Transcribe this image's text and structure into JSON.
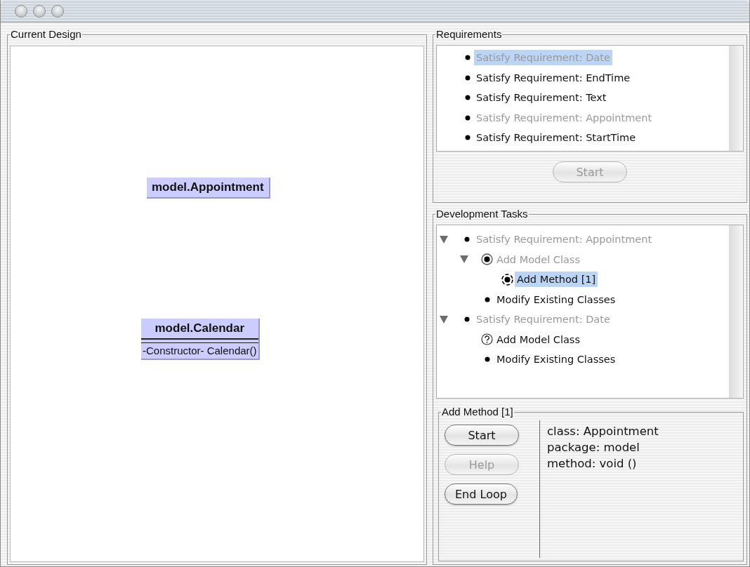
{
  "current_design": {
    "title": "Current Design",
    "classes": [
      {
        "kind": "name_only",
        "name": "model.Appointment"
      },
      {
        "kind": "full",
        "name": "model.Calendar",
        "methods": [
          "-Constructor- Calendar()"
        ]
      }
    ]
  },
  "requirements": {
    "title": "Requirements",
    "items": [
      {
        "label": "Satisfy Requirement: Date",
        "disabled": true,
        "selected": true
      },
      {
        "label": "Satisfy Requirement: EndTime",
        "disabled": false,
        "selected": false
      },
      {
        "label": "Satisfy Requirement: Text",
        "disabled": false,
        "selected": false
      },
      {
        "label": "Satisfy Requirement: Appointment",
        "disabled": true,
        "selected": false
      },
      {
        "label": "Satisfy Requirement: StartTime",
        "disabled": false,
        "selected": false
      }
    ],
    "button": {
      "label": "Start",
      "disabled": true
    }
  },
  "development_tasks": {
    "title": "Development Tasks",
    "items": [
      {
        "label": "Satisfy Requirement: Appointment",
        "kind": "bullet",
        "disabled": true,
        "selected": false,
        "expanded": true,
        "children": [
          {
            "label": "Add Model Class",
            "kind": "radio",
            "disabled": true,
            "selected": false,
            "expanded": true,
            "children": [
              {
                "label": "Add Method [1]",
                "kind": "busy",
                "disabled": false,
                "selected": true
              }
            ]
          },
          {
            "label": "Modify Existing Classes",
            "kind": "bullet",
            "disabled": false,
            "selected": false
          }
        ]
      },
      {
        "label": "Satisfy Requirement: Date",
        "kind": "bullet",
        "disabled": true,
        "selected": false,
        "expanded": true,
        "children": [
          {
            "label": "Add Model Class",
            "kind": "question",
            "disabled": false,
            "selected": false
          },
          {
            "label": "Modify Existing Classes",
            "kind": "bullet",
            "disabled": false,
            "selected": false
          }
        ]
      }
    ],
    "detail": {
      "title": "Add Method [1]",
      "buttons": [
        {
          "label": "Start",
          "disabled": false
        },
        {
          "label": "Help",
          "disabled": true
        },
        {
          "label": "End Loop",
          "disabled": false
        }
      ],
      "info": [
        "class: Appointment",
        "package: model",
        "method: void ()"
      ]
    }
  }
}
